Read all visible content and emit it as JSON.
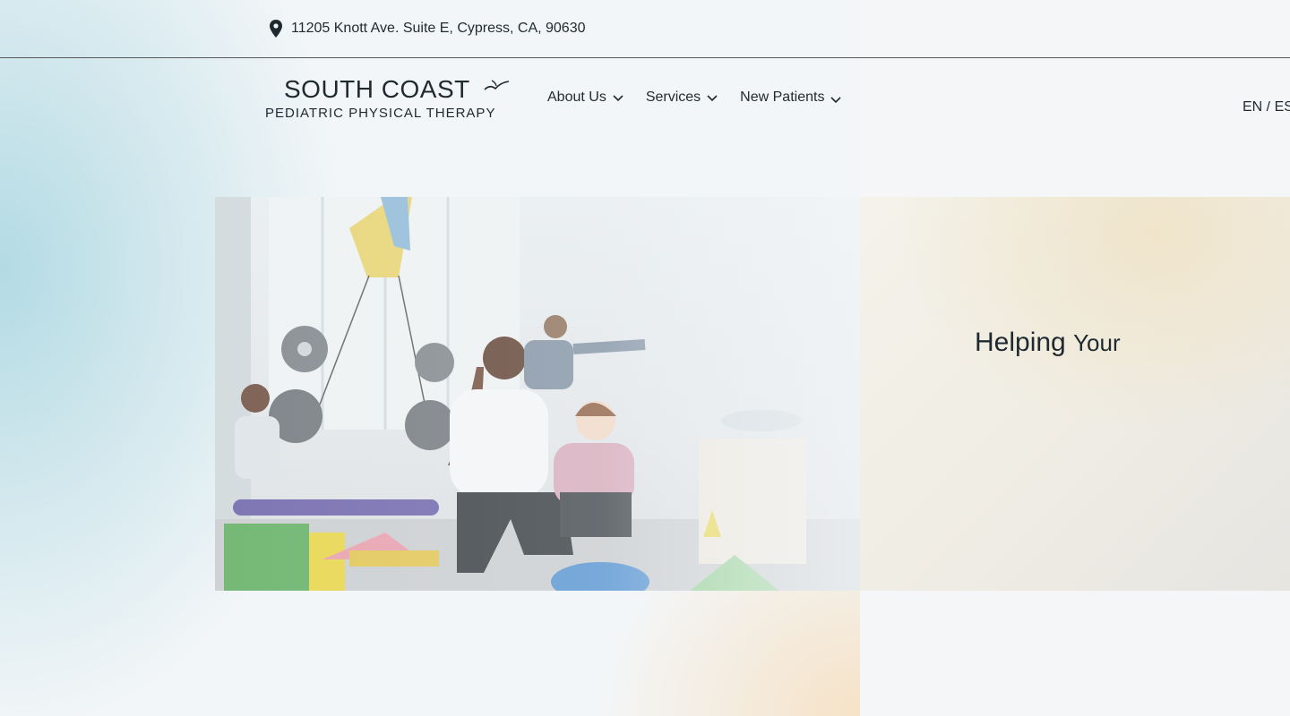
{
  "topbar": {
    "address": "11205 Knott Ave. Suite E, Cypress, CA, 90630",
    "address_icon": "map-pin-icon"
  },
  "header": {
    "logo": {
      "title": "SOUTH COAST",
      "subtitle": "PEDIATRIC PHYSICAL THERAPY",
      "icon": "bird-icon"
    },
    "nav": [
      {
        "label": "About Us",
        "icon": "chevron-down-icon"
      },
      {
        "label": "Services",
        "icon": "chevron-down-icon"
      },
      {
        "label": "New Patients",
        "icon": "chevron-down-icon"
      }
    ],
    "language": "EN / ES"
  },
  "hero": {
    "heading_word1": "Helping",
    "heading_word2": "Your",
    "image_description": ""
  },
  "colors": {
    "text": "#1f2a30",
    "accent_blue": "#a8d6e0",
    "accent_peach": "#f6e1c4",
    "panel_bg": "#f0ede4"
  }
}
